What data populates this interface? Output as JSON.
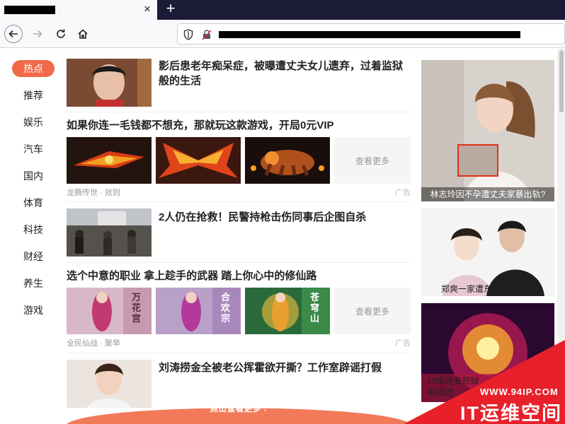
{
  "browser": {
    "newtab_label": "+",
    "close_label": "×"
  },
  "categories": [
    "热点",
    "推荐",
    "娱乐",
    "汽车",
    "国内",
    "体育",
    "科技",
    "财经",
    "养生",
    "游戏"
  ],
  "feed": {
    "article1": {
      "title": "影后患老年痴呆症，被曝遭丈夫女儿遗弃，过着监狱般的生活"
    },
    "ad1": {
      "title": "如果你连一毛钱都不想充，那就玩这款游戏，开局0元VIP",
      "more": "查看更多",
      "source": "龙腾传世 · 效则",
      "tag": "广告"
    },
    "article2": {
      "title": "2人仍在抢救！民警持枪击伤同事后企图自杀"
    },
    "ad2": {
      "title": "选个中意的职业 拿上趁手的武器 踏上你心中的修仙路",
      "more": "查看更多",
      "source": "全民仙战 · 聚举",
      "tag": "广告",
      "banners": [
        "万花宫",
        "合欢宗",
        "苍穹山"
      ]
    },
    "article3": {
      "title": "刘涛捞金全被老公挥霍欲开撕？工作室辟谣打假"
    },
    "load_more": "点击查看更多 ↓"
  },
  "sidebar": {
    "card1": {
      "caption": "林志玲因不孕遭丈夫家暴出轨?"
    },
    "card2": {
      "caption": "郑爽一家遭东北邻居嫌弃"
    },
    "card3": {
      "caption_line1": "10级送毒怒狱",
      "caption_line2": "40级送"
    }
  },
  "watermark": {
    "url": "WWW.94IP.COM",
    "text": "IT运维空间"
  },
  "colors": {
    "accent": "#f06a4a",
    "tabbar": "#1c1b37",
    "watermark": "#e8202a"
  }
}
